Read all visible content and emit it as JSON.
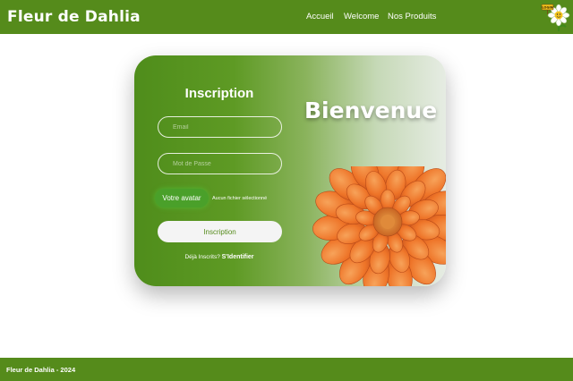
{
  "header": {
    "brand": "Fleur de Dahlia",
    "nav": [
      "Accueil",
      "Welcome",
      "Nos Produits"
    ],
    "logo_icon": "daisy-with-sign-icon",
    "logo_sign_text": "LOGIN"
  },
  "signup": {
    "title": "Inscription",
    "email_placeholder": "Email",
    "password_placeholder": "Mot de Passe",
    "avatar_button": "Votre avatar",
    "file_status": "Aucun fichier sélectionné",
    "submit_button": "Inscription",
    "login_prompt": "Déjà Inscrits?",
    "login_link": "S'Identifier"
  },
  "hero": {
    "welcome": "Bienvenue",
    "image_icon": "dahlia-flower-image"
  },
  "footer": {
    "text": "Fleur de Dahlia - 2024"
  },
  "colors": {
    "brand_green": "#558b1b",
    "accent_orange": "#f07a2a"
  }
}
